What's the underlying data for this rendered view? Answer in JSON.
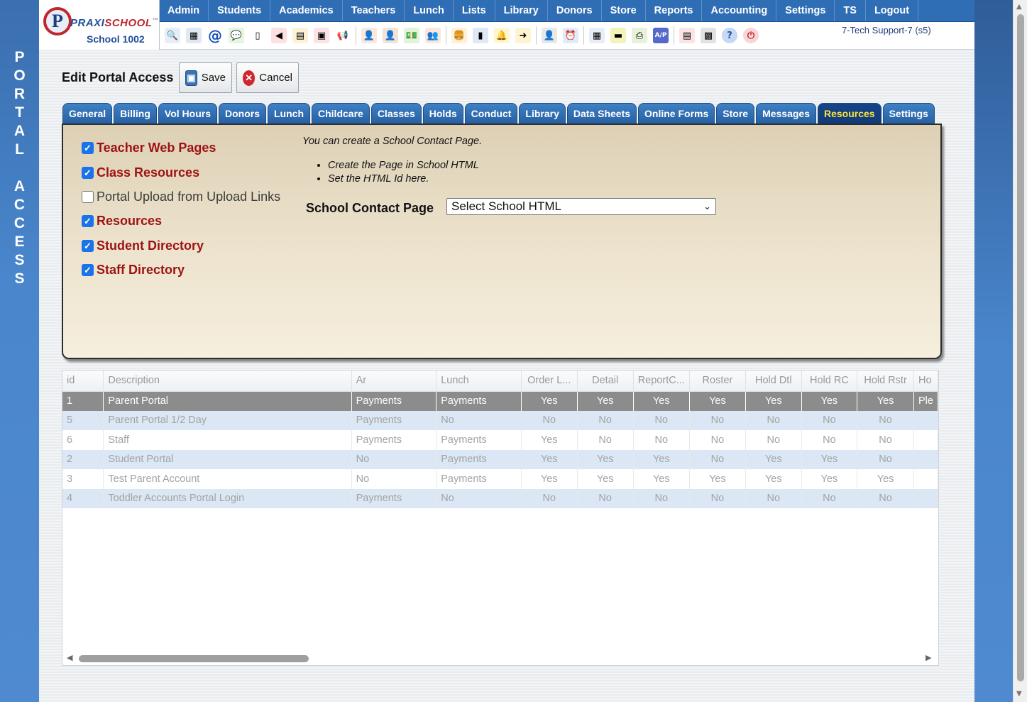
{
  "side_banner": {
    "letters": [
      "P",
      "O",
      "R",
      "T",
      "A",
      "L",
      " ",
      "A",
      "C",
      "C",
      "E",
      "S",
      "S"
    ]
  },
  "logo": {
    "mark": "P",
    "brand_a": "PRAXI",
    "brand_b": "SCHOOL",
    "tm": "™",
    "school": "School 1002"
  },
  "menu": [
    "Admin",
    "Students",
    "Academics",
    "Teachers",
    "Lunch",
    "Lists",
    "Library",
    "Donors",
    "Store",
    "Reports",
    "Accounting",
    "Settings",
    "TS",
    "Logout"
  ],
  "toolbar": [
    {
      "name": "search-icon",
      "glyph": "🔍",
      "color": "#e8eef7"
    },
    {
      "name": "calendar-grid-icon",
      "glyph": "▦",
      "color": "#dfe8f3"
    },
    {
      "name": "email-icon",
      "glyph": "@",
      "color": "#ffffff"
    },
    {
      "name": "chat-icon",
      "glyph": "💬",
      "color": "#e4f6dd"
    },
    {
      "name": "mobile-phone-icon",
      "glyph": "▯",
      "color": "#ffffff"
    },
    {
      "name": "speaker-icon",
      "glyph": "◀",
      "color": "#fde0e0"
    },
    {
      "name": "grades-icon",
      "glyph": "▤",
      "color": "#fff1d6"
    },
    {
      "name": "calendar-icon",
      "glyph": "▣",
      "color": "#fde4e4"
    },
    {
      "name": "megaphone-icon",
      "glyph": "📢",
      "color": "#ffffff"
    },
    {
      "sep": true
    },
    {
      "name": "add-student-icon",
      "glyph": "👤",
      "color": "#fbe7dc"
    },
    {
      "name": "student-icon",
      "glyph": "👤",
      "color": "#f3e3d4"
    },
    {
      "name": "money-icon",
      "glyph": "💵",
      "color": "#e2f3da"
    },
    {
      "name": "parents-icon",
      "glyph": "👥",
      "color": "#fbe7dc"
    },
    {
      "sep": true
    },
    {
      "name": "lunch-icon",
      "glyph": "🍔",
      "color": "#fff1d6"
    },
    {
      "name": "notebook-icon",
      "glyph": "▮",
      "color": "#dfe8f3"
    },
    {
      "name": "bell-icon",
      "glyph": "🔔",
      "color": "#fff6cf"
    },
    {
      "name": "export-icon",
      "glyph": "➜",
      "color": "#fff4d0"
    },
    {
      "sep": true
    },
    {
      "name": "teacher-icon",
      "glyph": "👤",
      "color": "#e8e8e8"
    },
    {
      "name": "clock-icon",
      "glyph": "⏰",
      "color": "#e0ecf9"
    },
    {
      "sep": true
    },
    {
      "name": "spreadsheet-icon",
      "glyph": "▦",
      "color": "#e8eef7"
    },
    {
      "name": "id-card-icon",
      "glyph": "▬",
      "color": "#f4f4b8"
    },
    {
      "name": "printer-icon",
      "glyph": "⎙",
      "color": "#e8f2d8"
    },
    {
      "name": "accounts-payable-icon",
      "glyph": "A/P",
      "color": "#5469c9"
    },
    {
      "sep": true
    },
    {
      "name": "pdf-icon",
      "glyph": "▤",
      "color": "#fde4e4"
    },
    {
      "name": "cash-register-icon",
      "glyph": "▩",
      "color": "#e2e2e2"
    },
    {
      "name": "help-icon",
      "glyph": "?",
      "color": "#c6d8f3"
    },
    {
      "name": "power-icon",
      "glyph": "⏻",
      "color": "#f6d6d6"
    }
  ],
  "user": "7-Tech Support-7 (s5)",
  "page": {
    "title": "Edit Portal Access",
    "save": "Save",
    "cancel": "Cancel"
  },
  "tabs": [
    "General",
    "Billing",
    "Vol Hours",
    "Donors",
    "Lunch",
    "Childcare",
    "Classes",
    "Holds",
    "Conduct",
    "Library",
    "Data Sheets",
    "Online Forms",
    "Store",
    "Messages",
    "Resources",
    "Settings"
  ],
  "active_tab": "Resources",
  "options": [
    {
      "label": "Teacher Web Pages",
      "checked": true
    },
    {
      "label": "Class Resources",
      "checked": true
    },
    {
      "label": "Portal Upload from Upload Links",
      "checked": false
    },
    {
      "label": "Resources",
      "checked": true
    },
    {
      "label": "Student Directory",
      "checked": true
    },
    {
      "label": "Staff Directory",
      "checked": true
    }
  ],
  "info": {
    "intro": "You can create a School Contact Page.",
    "steps": [
      "Create the Page in School HTML",
      "Set the HTML Id here."
    ],
    "contact_label": "School Contact Page",
    "contact_value": "Select School HTML"
  },
  "grid": {
    "columns": [
      "id",
      "Description",
      "Ar",
      "Lunch",
      "Order L...",
      "Detail",
      "ReportC...",
      "Roster",
      "Hold Dtl",
      "Hold RC",
      "Hold Rstr",
      "Ho"
    ],
    "rows": [
      [
        "1",
        "Parent Portal",
        "Payments",
        "Payments",
        "Yes",
        "Yes",
        "Yes",
        "Yes",
        "Yes",
        "Yes",
        "Yes",
        "Ple"
      ],
      [
        "5",
        "Parent Portal 1/2 Day",
        "Payments",
        "No",
        "No",
        "No",
        "No",
        "No",
        "No",
        "No",
        "No",
        ""
      ],
      [
        "6",
        "Staff",
        "Payments",
        "Payments",
        "Yes",
        "No",
        "No",
        "No",
        "No",
        "No",
        "No",
        ""
      ],
      [
        "2",
        "Student Portal",
        "No",
        "Payments",
        "Yes",
        "Yes",
        "Yes",
        "No",
        "Yes",
        "Yes",
        "No",
        ""
      ],
      [
        "3",
        "Test Parent Account",
        "No",
        "Payments",
        "Yes",
        "Yes",
        "Yes",
        "Yes",
        "Yes",
        "Yes",
        "Yes",
        ""
      ],
      [
        "4",
        "Toddler Accounts Portal Login",
        "Payments",
        "No",
        "No",
        "No",
        "No",
        "No",
        "No",
        "No",
        "No",
        ""
      ]
    ],
    "selected_row": 0
  }
}
